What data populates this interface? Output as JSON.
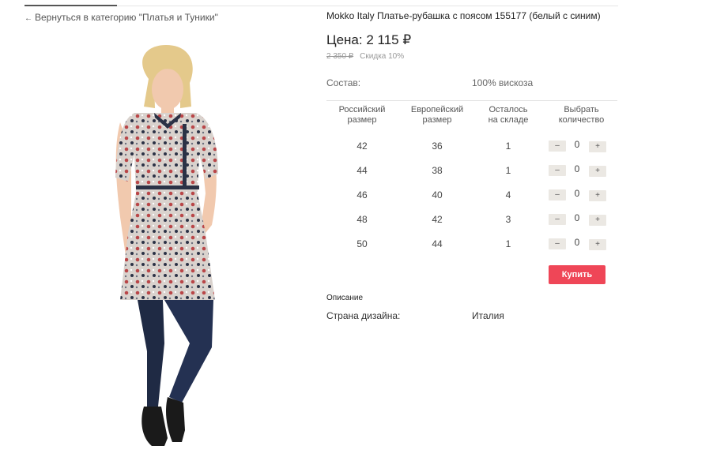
{
  "nav": {
    "back_label": "Вернуться в категорию \"Платья и Туники\""
  },
  "product": {
    "title": "Mokko Italy Платье-рубашка с поясом 155177 (белый с синим)",
    "price": "Цена: 2 115 ₽",
    "old_price": "2 350 ₽",
    "discount": "Скидка 10%",
    "composition_label": "Состав:",
    "composition_value": "100% вискоза"
  },
  "size_table": {
    "headers": {
      "ru": [
        "Российский",
        "размер"
      ],
      "eu": [
        "Европейский",
        "размер"
      ],
      "stock": [
        "Осталось",
        "на складе"
      ],
      "qty": [
        "Выбрать",
        "количество"
      ]
    },
    "rows": [
      {
        "ru": "42",
        "eu": "36",
        "stock": "1",
        "qty": "0"
      },
      {
        "ru": "44",
        "eu": "38",
        "stock": "1",
        "qty": "0"
      },
      {
        "ru": "46",
        "eu": "40",
        "stock": "4",
        "qty": "0"
      },
      {
        "ru": "48",
        "eu": "42",
        "stock": "3",
        "qty": "0"
      },
      {
        "ru": "50",
        "eu": "44",
        "stock": "1",
        "qty": "0"
      }
    ],
    "minus_label": "–",
    "plus_label": "+"
  },
  "actions": {
    "buy_label": "Купить"
  },
  "description": {
    "heading": "Описание",
    "country_label": "Страна дизайна:",
    "country_value": "Италия"
  },
  "colors": {
    "buy_button": "#ef4657",
    "qty_button": "#ebe8e3"
  }
}
